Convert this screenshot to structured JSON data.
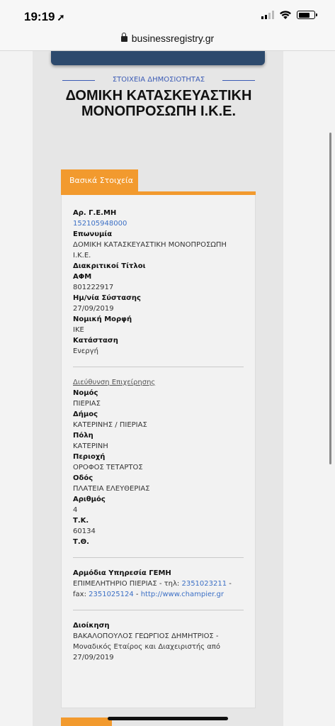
{
  "status_bar": {
    "time": "19:19",
    "location_arrow": "➚"
  },
  "browser": {
    "url": "businessregistry.gr"
  },
  "header": {
    "section_label": "ΣΤΟΙΧΕΙΑ ΔΗΜΟΣΙΟΤΗΤΑΣ",
    "company_title": "ΔΟΜΙΚΗ ΚΑΤΑΣΚΕΥΑΣΤΙΚΗ ΜΟΝΟΠΡΟΣΩΠΗ Ι.Κ.Ε."
  },
  "tab": {
    "label": "Βασικά Στοιχεία"
  },
  "basic": {
    "gemh_label": "Αρ. Γ.Ε.ΜΗ",
    "gemh_value": "152105948000",
    "name_label": "Επωνυμία",
    "name_value": "ΔΟΜΙΚΗ ΚΑΤΑΣΚΕΥΑΣΤΙΚΗ ΜΟΝΟΠΡΟΣΩΠΗ Ι.Κ.Ε.",
    "titles_label": "Διακριτικοί Τίτλοι",
    "afm_label": "ΑΦΜ",
    "afm_value": "801222917",
    "founded_label": "Ημ/νία Σύστασης",
    "founded_value": "27/09/2019",
    "legal_label": "Νομική Μορφή",
    "legal_value": "ΙΚΕ",
    "status_label": "Κατάσταση",
    "status_value": "Ενεργή"
  },
  "address": {
    "heading": "Διεύθυνση Επιχείρησης",
    "nomos_label": "Νομός",
    "nomos_value": "ΠΙΕΡΙΑΣ",
    "dimos_label": "Δήμος",
    "dimos_value": "ΚΑΤΕΡΙΝΗΣ / ΠΙΕΡΙΑΣ",
    "poli_label": "Πόλη",
    "poli_value": "ΚΑΤΕΡΙΝΗ",
    "perioxi_label": "Περιοχή",
    "perioxi_value": "ΟΡΟΦΟΣ ΤΕΤΑΡΤΟΣ",
    "odos_label": "Οδός",
    "odos_value": "ΠΛΑΤΕΙΑ ΕΛΕΥΘΕΡΙΑΣ",
    "arithmos_label": "Αριθμός",
    "arithmos_value": "4",
    "tk_label": "Τ.Κ.",
    "tk_value": "60134",
    "tth_label": "Τ.Θ."
  },
  "gemh_service": {
    "label": "Αρμόδια Υπηρεσία ΓΕΜΗ",
    "prefix": "ΕΠΙΜΕΛΗΤΗΡΙΟ ΠΙΕΡΙΑΣ - τηλ: ",
    "phone": "2351023211",
    "fax_prefix": " - fax: ",
    "fax": "2351025124",
    "sep": " - ",
    "website": "http://www.champier.gr"
  },
  "management": {
    "label": "Διοίκηση",
    "value": "ΒΑΚΑΛΟΠΟΥΛΟΣ ΓΕΩΡΓΙΟΣ ΔΗΜΗΤΡΙΟΣ - Μοναδικός Εταίρος και Διαχειριστής από 27/09/2019"
  },
  "colors": {
    "accent": "#f29a2e",
    "link": "#3b6fc5",
    "nav": "#2d4a6d"
  }
}
